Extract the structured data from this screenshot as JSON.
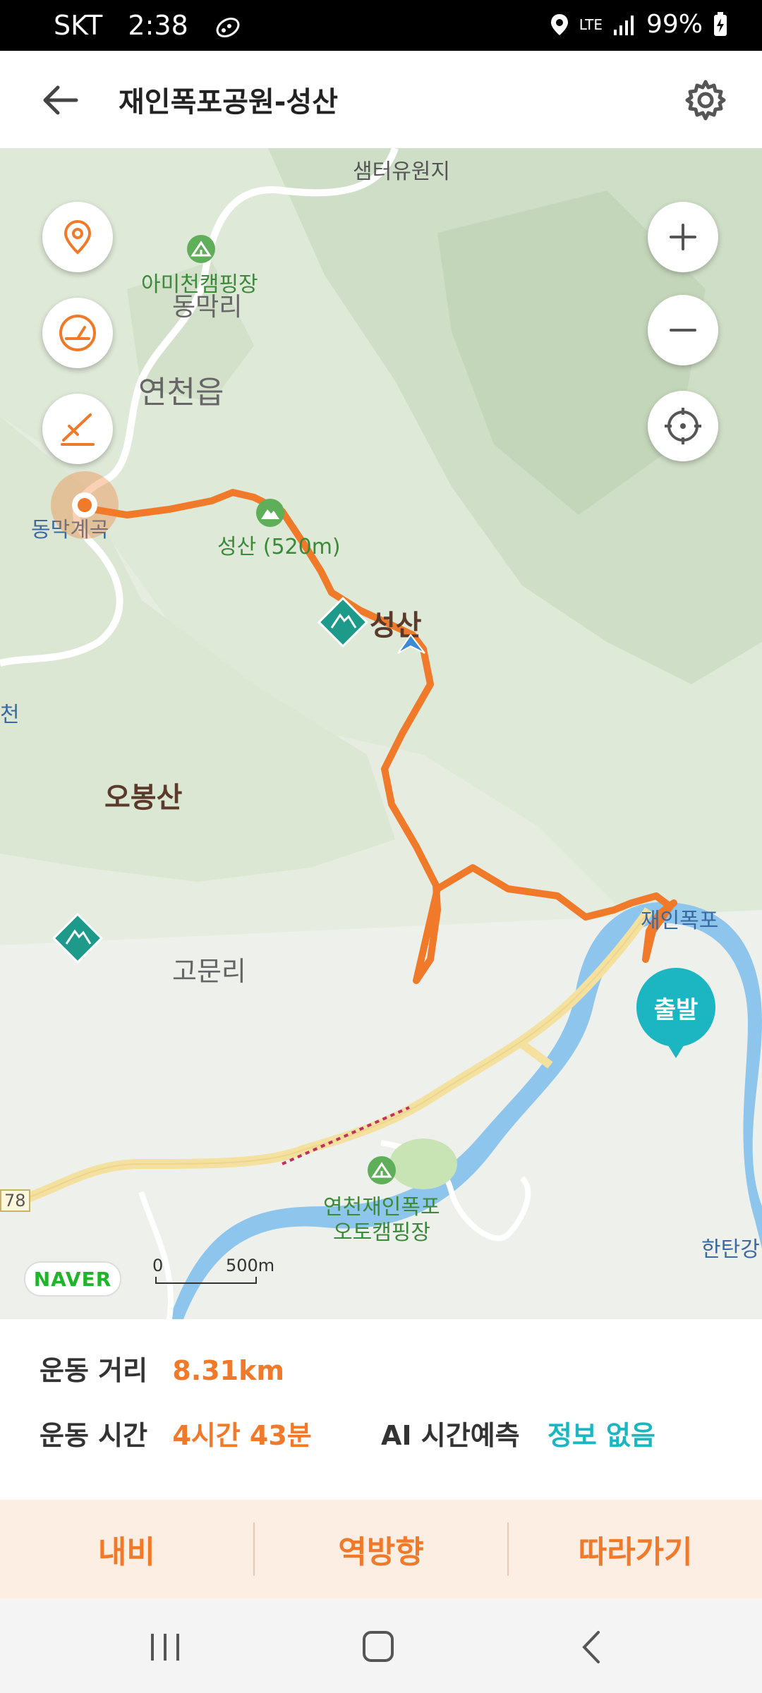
{
  "status_bar": {
    "carrier": "SKT",
    "time": "2:38",
    "network": "LTE",
    "battery": "99%",
    "icons": [
      "running-icon",
      "location-icon",
      "lte-icon",
      "signal-icon",
      "battery-charging-icon"
    ]
  },
  "header": {
    "title": "재인폭포공원-성산",
    "back_icon": "back-arrow-icon",
    "settings_icon": "gear-icon"
  },
  "map": {
    "labels": {
      "samteo": "샘터유원지",
      "amicheon": "아미천캠핑장",
      "dongmak": "동막리",
      "yeoncheon": "연천읍",
      "dongmak_valley": "동막계곡",
      "seongsan_small": "성산 (520m)",
      "seongsan": "성산",
      "cheon": "천",
      "obongsan": "오봉산",
      "gomun": "고문리",
      "jaein": "재인폭포",
      "camping": "연천재인폭포",
      "camping2": "오토캠핑장",
      "hantan": "한탄강",
      "road_num": "78"
    },
    "left_controls": [
      "location-pin-icon",
      "speedometer-icon",
      "elevation-icon"
    ],
    "right_controls": [
      "zoom-in-icon",
      "zoom-out-icon",
      "crosshair-icon"
    ],
    "start_marker": "출발",
    "logo": "NAVER",
    "scale": {
      "zero": "0",
      "distance": "500m"
    },
    "colors": {
      "route": "#f07a2a",
      "river": "#8ec5ec",
      "road": "#f4e1a0",
      "accent": "#1bb6c1"
    }
  },
  "stats": {
    "distance_label": "운동 거리",
    "distance_value": "8.31km",
    "time_label": "운동 시간",
    "time_value": "4시간 43분",
    "ai_label": "AI 시간예측",
    "ai_value": "정보 없음"
  },
  "actions": {
    "navi": "내비",
    "reverse": "역방향",
    "follow": "따라가기"
  },
  "nav_bar": [
    "recent-apps-icon",
    "home-icon",
    "back-icon"
  ]
}
